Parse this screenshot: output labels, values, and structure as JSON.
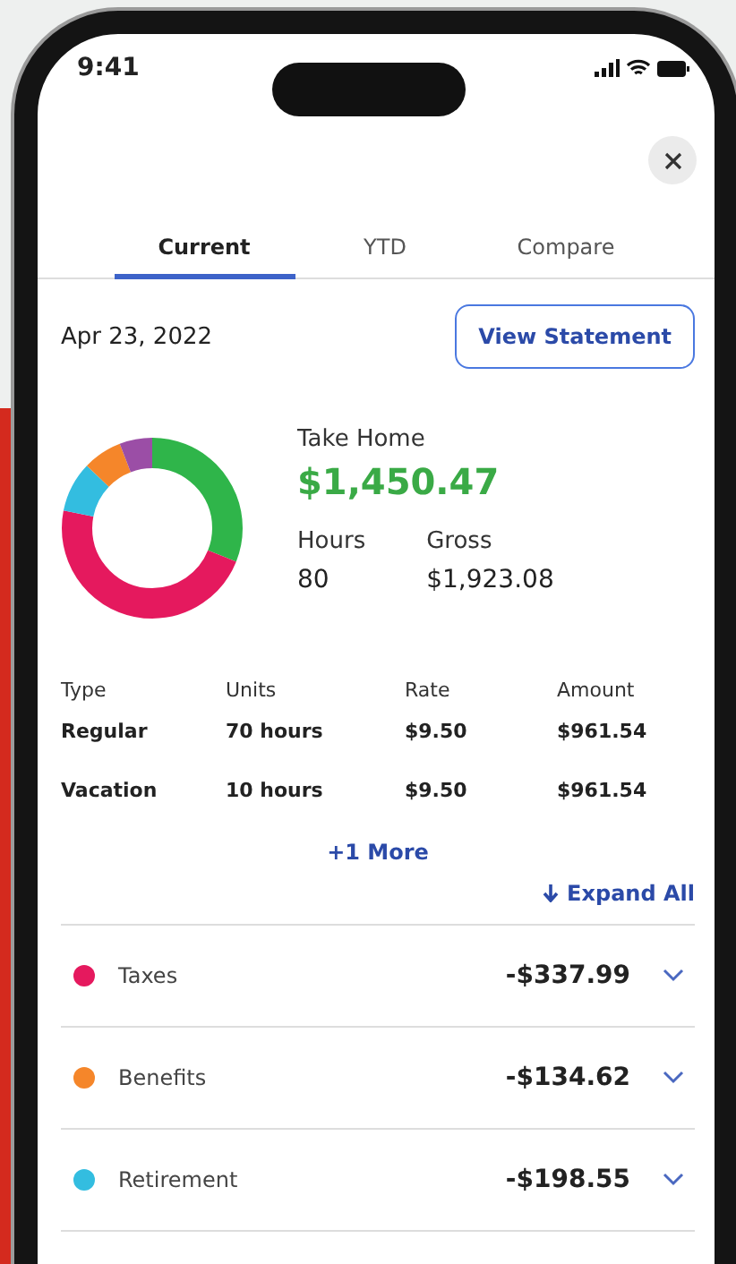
{
  "status_bar": {
    "time": "9:41"
  },
  "tabs": [
    {
      "label": "Current",
      "selected": true
    },
    {
      "label": "YTD",
      "selected": false
    },
    {
      "label": "Compare",
      "selected": false
    }
  ],
  "statement": {
    "date": "Apr 23, 2022",
    "button": "View Statement"
  },
  "summary": {
    "take_home_label": "Take Home",
    "take_home": "$1,450.47",
    "hours_label": "Hours",
    "hours": "80",
    "gross_label": "Gross",
    "gross": "$1,923.08"
  },
  "earnings": {
    "columns": [
      "Type",
      "Units",
      "Rate",
      "Amount"
    ],
    "rows": [
      [
        "Regular",
        "70 hours",
        "$9.50",
        "$961.54"
      ],
      [
        "Vacation",
        "10 hours",
        "$9.50",
        "$961.54"
      ]
    ],
    "more_link": "+1 More"
  },
  "expand_all": "Expand All",
  "deductions": [
    {
      "label": "Taxes",
      "amount": "-$337.99",
      "color": "#e5195e",
      "expanded": false
    },
    {
      "label": "Benefits",
      "amount": "-$134.62",
      "color": "#f5862a",
      "expanded": false
    },
    {
      "label": "Retirement",
      "amount": "-$198.55",
      "color": "#33bde0",
      "expanded": false
    }
  ]
}
